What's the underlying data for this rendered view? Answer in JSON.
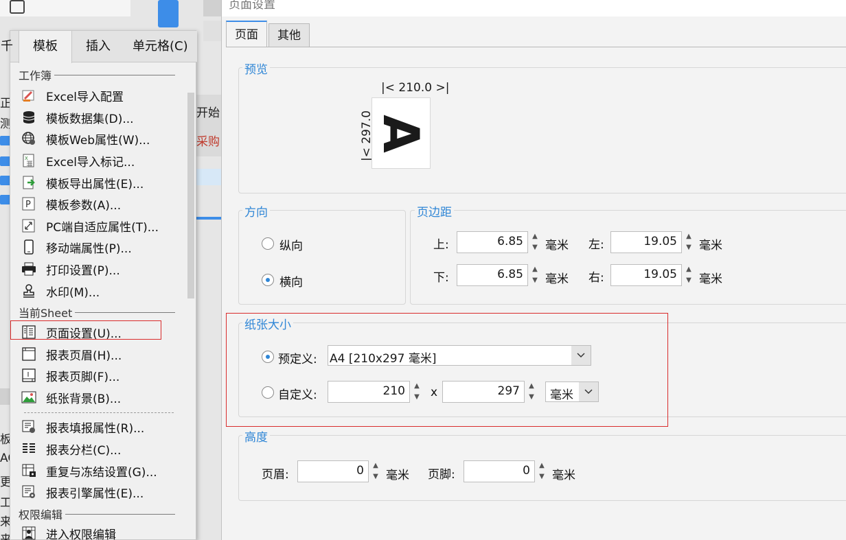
{
  "background": {
    "left_chars": [
      "正",
      "测",
      "板",
      "AC",
      "更",
      "工",
      "来",
      "来"
    ],
    "mid_texts": [
      "开始",
      "采购"
    ]
  },
  "menu": {
    "tabs": [
      "千",
      "模板",
      "插入",
      "单元格(C)"
    ],
    "sections": {
      "workbook": "工作簿",
      "current_sheet": "当前Sheet",
      "permission": "权限编辑"
    },
    "workbook_items": [
      {
        "label": "Excel导入配置",
        "icon": "excel-import-config-icon"
      },
      {
        "label": "模板数据集(D)...",
        "icon": "database-icon"
      },
      {
        "label": "模板Web属性(W)...",
        "icon": "globe-icon"
      },
      {
        "label": "Excel导入标记...",
        "icon": "excel-mark-icon"
      },
      {
        "label": "模板导出属性(E)...",
        "icon": "export-icon"
      },
      {
        "label": "模板参数(A)...",
        "icon": "parameter-icon"
      },
      {
        "label": "PC端自适应属性(T)...",
        "icon": "resize-icon"
      },
      {
        "label": "移动端属性(P)...",
        "icon": "mobile-icon"
      },
      {
        "label": "打印设置(P)...",
        "icon": "printer-icon"
      },
      {
        "label": "水印(M)...",
        "icon": "stamp-icon"
      }
    ],
    "sheet_items": [
      {
        "label": "页面设置(U)...",
        "icon": "page-setup-icon"
      },
      {
        "label": "报表页眉(H)...",
        "icon": "header-icon"
      },
      {
        "label": "报表页脚(F)...",
        "icon": "footer-icon"
      },
      {
        "label": "纸张背景(B)...",
        "icon": "image-icon"
      }
    ],
    "sheet_items2": [
      {
        "label": "报表填报属性(R)...",
        "icon": "fill-attr-icon"
      },
      {
        "label": "报表分栏(C)...",
        "icon": "columns-icon"
      },
      {
        "label": "重复与冻结设置(G)...",
        "icon": "freeze-icon"
      },
      {
        "label": "报表引擎属性(E)...",
        "icon": "engine-icon"
      }
    ],
    "permission_items": [
      {
        "label": "进入权限编辑",
        "icon": "permission-icon"
      }
    ]
  },
  "dialog": {
    "title": "页面设置",
    "tabs": [
      "页面",
      "其他"
    ],
    "preview": {
      "title": "预览",
      "width": "210.0",
      "height": "297.0",
      "letter": "A"
    },
    "orientation": {
      "title": "方向",
      "portrait": "纵向",
      "landscape": "横向",
      "selected": "landscape"
    },
    "margins": {
      "title": "页边距",
      "top_label": "上:",
      "top": "6.85",
      "bottom_label": "下:",
      "bottom": "6.85",
      "left_label": "左:",
      "left": "19.05",
      "right_label": "右:",
      "right": "19.05",
      "unit": "毫米"
    },
    "paper": {
      "title": "纸张大小",
      "predefined_label": "预定义:",
      "predefined_value": "A4 [210x297 毫米]",
      "custom_label": "自定义:",
      "custom_width": "210",
      "times": "x",
      "custom_height": "297",
      "custom_unit": "毫米",
      "selected": "predefined"
    },
    "height": {
      "title": "高度",
      "header_label": "页眉:",
      "header_value": "0",
      "footer_label": "页脚:",
      "footer_value": "0",
      "unit": "毫米"
    }
  },
  "colors": {
    "accent": "#2f86d6",
    "highlight": "#d92b2b"
  }
}
